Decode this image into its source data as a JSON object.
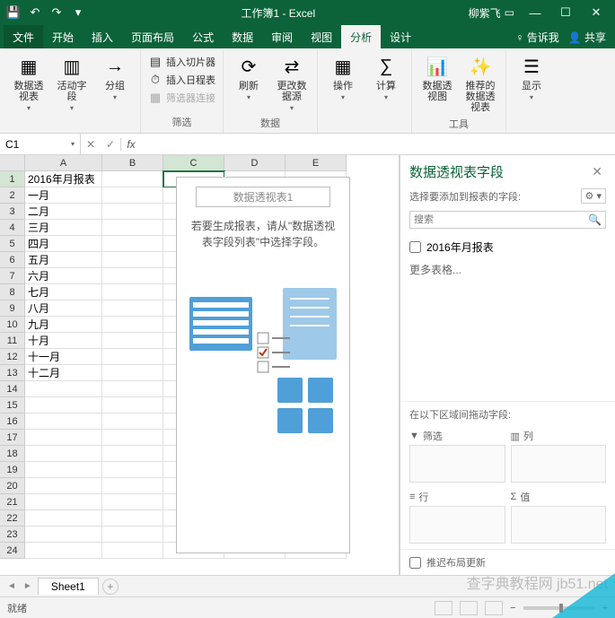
{
  "titlebar": {
    "title": "工作簿1 - Excel",
    "user": "柳紫飞"
  },
  "tabs": {
    "file": "文件",
    "home": "开始",
    "insert": "插入",
    "layout": "页面布局",
    "formulas": "公式",
    "data": "数据",
    "review": "审阅",
    "view": "视图",
    "analyze": "分析",
    "design": "设计",
    "tellme": "告诉我",
    "share": "共享"
  },
  "ribbon": {
    "pivot_table": "数据透视表",
    "active_field": "活动字段",
    "group": "分组",
    "insert_slicer": "插入切片器",
    "insert_timeline": "插入日程表",
    "filter_connections": "筛选器连接",
    "filter_group": "筛选",
    "refresh": "刷新",
    "change_source": "更改数据源",
    "data_group": "数据",
    "actions": "操作",
    "calc": "计算",
    "pivot_chart": "数据透视图",
    "recommended": "推荐的数据透视表",
    "tools_group": "工具",
    "show": "显示"
  },
  "namebox": "C1",
  "columns": [
    "A",
    "B",
    "C",
    "D",
    "E"
  ],
  "rows": [
    {
      "n": 1,
      "a": "2016年月报表"
    },
    {
      "n": 2,
      "a": "一月"
    },
    {
      "n": 3,
      "a": "二月"
    },
    {
      "n": 4,
      "a": "三月"
    },
    {
      "n": 5,
      "a": "四月"
    },
    {
      "n": 6,
      "a": "五月"
    },
    {
      "n": 7,
      "a": "六月"
    },
    {
      "n": 8,
      "a": "七月"
    },
    {
      "n": 9,
      "a": "八月"
    },
    {
      "n": 10,
      "a": "九月"
    },
    {
      "n": 11,
      "a": "十月"
    },
    {
      "n": 12,
      "a": "十一月"
    },
    {
      "n": 13,
      "a": "十二月"
    },
    {
      "n": 14,
      "a": ""
    },
    {
      "n": 15,
      "a": ""
    },
    {
      "n": 16,
      "a": ""
    },
    {
      "n": 17,
      "a": ""
    },
    {
      "n": 18,
      "a": ""
    },
    {
      "n": 19,
      "a": ""
    },
    {
      "n": 20,
      "a": ""
    },
    {
      "n": 21,
      "a": ""
    },
    {
      "n": 22,
      "a": ""
    },
    {
      "n": 23,
      "a": ""
    },
    {
      "n": 24,
      "a": ""
    }
  ],
  "pivot_placeholder": {
    "title": "数据透视表1",
    "msg1": "若要生成报表，请从\"数据透视表字段列表\"中选择字段。"
  },
  "taskpane": {
    "title": "数据透视表字段",
    "choose": "选择要添加到报表的字段:",
    "search_ph": "搜索",
    "field1": "2016年月报表",
    "more": "更多表格...",
    "areas_label": "在以下区域间拖动字段:",
    "filters": "筛选",
    "columns": "列",
    "rows_l": "行",
    "values": "值",
    "defer": "推迟布局更新"
  },
  "sheet": {
    "name": "Sheet1"
  },
  "status": {
    "ready": "就绪",
    "zoom": "100%"
  },
  "watermark": "查字典教程网 jb51.net"
}
